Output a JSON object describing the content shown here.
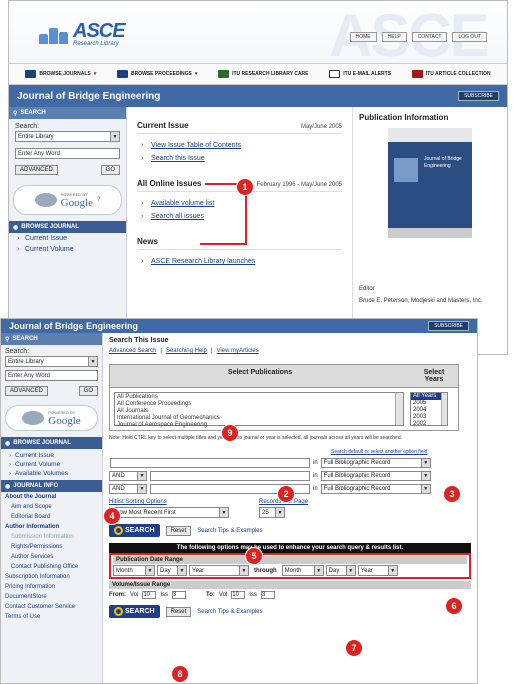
{
  "header": {
    "logo_main": "ASCE",
    "logo_sub": "Research Library",
    "top_links": [
      "HOME",
      "HELP",
      "CONTACT",
      "LOG OUT"
    ]
  },
  "nav": {
    "items": [
      "BROWSE JOURNALS",
      "BROWSE PROCEEDINGS",
      "ITU RESEARCH LIBRARY CARE",
      "ITU E-MAIL ALERTS",
      "ITU ARTICLE COLLECTION"
    ]
  },
  "journal": {
    "title": "Journal of Bridge Engineering",
    "subscribe": "SUBSCRIBE"
  },
  "left": {
    "search_head": "SEARCH",
    "search_label": "Search:",
    "search_select": "Entire Library",
    "search_placeholder": "Enter Any Word",
    "advanced": "ADVANCED",
    "go": "GO",
    "powered": "POWERED BY",
    "google": "Google",
    "browse_head": "BROWSE JOURNAL",
    "browse_items": [
      "Current Issue",
      "Current Volume",
      "Available Volumes"
    ],
    "info_head": "JOURNAL INFO"
  },
  "center": {
    "current_issue": "Current Issue",
    "current_issue_date": "May/June 2005",
    "current_links": [
      "View Issue Table of Contents",
      "Search this Issue"
    ],
    "online_issues": "All Online Issues",
    "online_date": "February 1996 - May/June 2005",
    "online_links": [
      "Available volume list",
      "Search all issues"
    ],
    "news": "News",
    "news_links": [
      "ASCE Research Library launches"
    ]
  },
  "right": {
    "title": "Publication Information",
    "cover_title": "Journal of Bridge Engineering",
    "editor_label": "Editor",
    "editor_name": "Bruce E. Peterson, Modjeski and Masters, Inc."
  },
  "search_page": {
    "title": "Search This Issue",
    "links": [
      "Advanced Search",
      "Searching Help",
      "View myArticles"
    ],
    "pub_header": "Select Publications",
    "year_header": "Select Years",
    "publications": [
      "All Publications",
      "All Conference Proceedings",
      "All Journals",
      "International Journal of Geomechanics",
      "Journal of Aerospace Engineering"
    ],
    "years": [
      "All Years",
      "2005",
      "2004",
      "2003",
      "2002"
    ],
    "note": "Note: Hold CTRL key to select multiple titles and years. If no journal or year is selected, all journals across all years will be searched.",
    "default_label": "Search default or select another option field",
    "in_label": "in",
    "field_value": "Full Bibliographic Record",
    "and_label": "AND",
    "sorting_label": "Hitlist Sorting Options",
    "sorting_value": "Show Most Recent First",
    "records_label": "Records Per Page",
    "records_value": "25",
    "search_btn": "SEARCH",
    "reset_btn": "Reset",
    "tips": "Search Tips & Examples",
    "enhance_bar": "The following options may be used to enhance your search query & results list.",
    "date_range": "Publication Date Range",
    "month": "Month",
    "day": "Day",
    "year": "Year",
    "through": "through",
    "vol_range": "Volume/Issue Range",
    "from": "From:",
    "vol": "Vol",
    "iss": "Iss",
    "to": "To:",
    "from_vol": "10",
    "from_iss": "3",
    "to_vol": "10",
    "to_iss": "3"
  },
  "left2": {
    "info_items": [
      "About the Journal",
      "Aim and Scope",
      "Editorial Board",
      "Author Information",
      "Submission Information",
      "Rights/Permissions",
      "Author Services",
      "Contact Publishing Office",
      "Subscription Information",
      "Pricing Information",
      "DocumentStore",
      "Contact Customer Service",
      "Terms of Use"
    ]
  },
  "markers": [
    "1",
    "2",
    "3",
    "4",
    "5",
    "6",
    "7",
    "8",
    "9"
  ]
}
